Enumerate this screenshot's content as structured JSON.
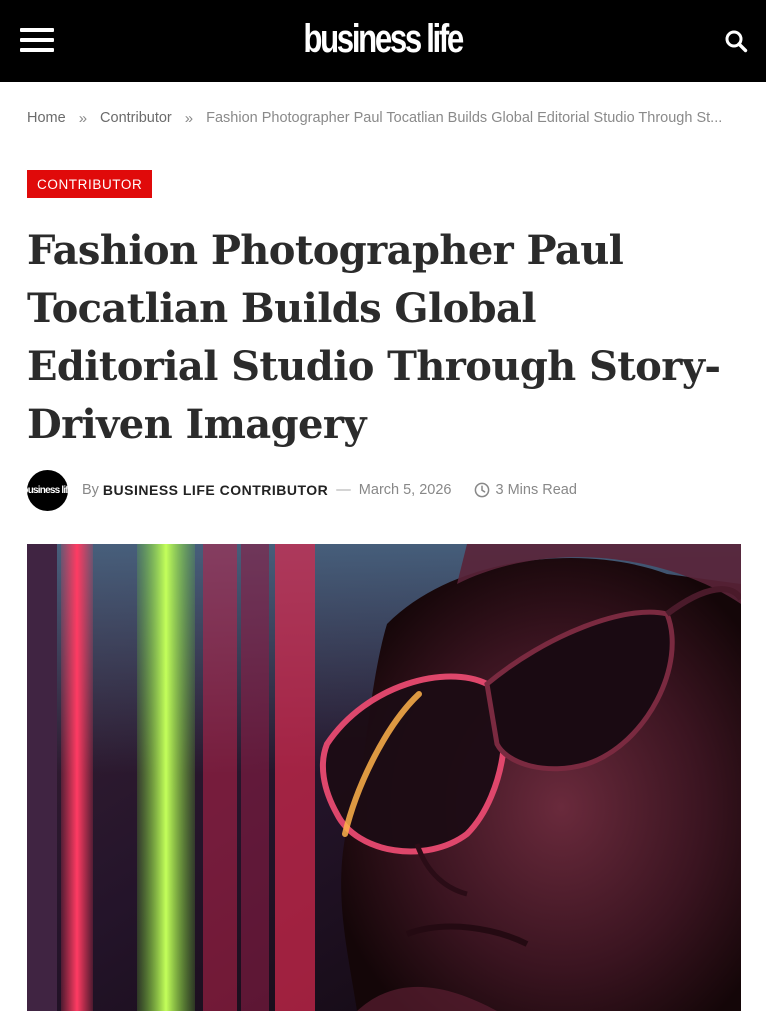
{
  "header": {
    "logo_text": "business life",
    "menu_icon": "hamburger-menu-icon",
    "search_icon": "search-icon",
    "background": "#000000"
  },
  "breadcrumb": {
    "home": "Home",
    "separator": "»",
    "section": "Contributor",
    "current": "Fashion Photographer Paul Tocatlian Builds Global Editorial Studio Through St..."
  },
  "article": {
    "category": "CONTRIBUTOR",
    "category_color": "#e00a0a",
    "title": "Fashion Photographer Paul Tocatlian Builds Global Editorial Studio Through Story-Driven Imagery",
    "byline_prefix": "By",
    "author": "BUSINESS LIFE CONTRIBUTOR",
    "meta_separator": "—",
    "date": "March 5, 2026",
    "read_time": "3 Mins Read",
    "avatar_text": "business life",
    "clock_icon": "clock-icon"
  }
}
